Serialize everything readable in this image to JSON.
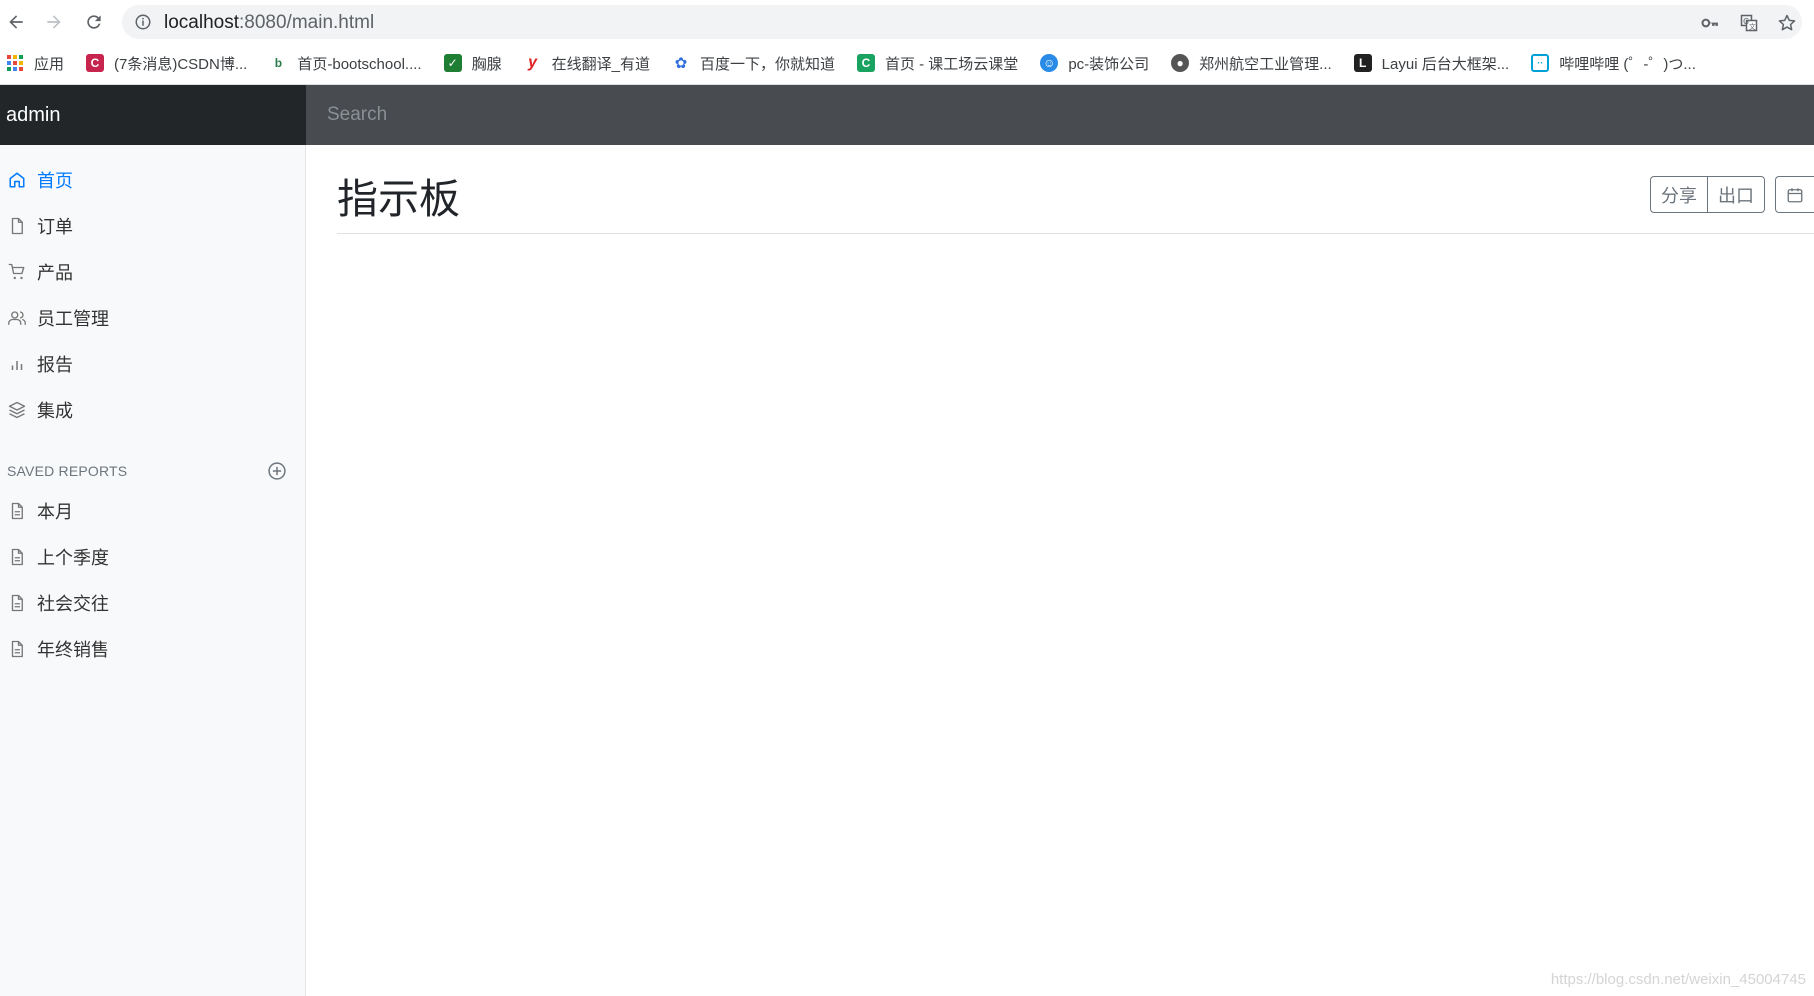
{
  "browser": {
    "url_host": "localhost",
    "url_rest": ":8080/main.html",
    "bookmarks": [
      {
        "label": "应用",
        "icon": "apps-grid-icon",
        "color": "#e8453c"
      },
      {
        "label": "(7条消息)CSDN博...",
        "icon": "csdn-icon",
        "color": "#c7254e"
      },
      {
        "label": "首页-bootschool....",
        "icon": "bootschool-icon",
        "color": "#2b7a4b"
      },
      {
        "label": "胸腺",
        "icon": "leaf-icon",
        "color": "#1e7e34"
      },
      {
        "label": "在线翻译_有道",
        "icon": "youdao-icon",
        "color": "#e02020"
      },
      {
        "label": "百度一下，你就知道",
        "icon": "baidu-paw-icon",
        "color": "#2f6fe0"
      },
      {
        "label": "首页 - 课工场云课堂",
        "icon": "kgc-icon",
        "color": "#1aa260"
      },
      {
        "label": "pc-装饰公司",
        "icon": "mascot-icon",
        "color": "#2a8be6"
      },
      {
        "label": "郑州航空工业管理...",
        "icon": "globe-icon",
        "color": "#555555"
      },
      {
        "label": "Layui 后台大框架...",
        "icon": "layui-icon",
        "color": "#222222"
      },
      {
        "label": "哔哩哔哩 (゜-゜)つ...",
        "icon": "bilibili-icon",
        "color": "#00a1d6"
      }
    ]
  },
  "header": {
    "brand": "admin",
    "search_placeholder": "Search"
  },
  "sidebar": {
    "items": [
      {
        "label": "首页",
        "icon": "home-icon",
        "active": true
      },
      {
        "label": "订单",
        "icon": "file-icon",
        "active": false
      },
      {
        "label": "产品",
        "icon": "shopping-cart-icon",
        "active": false
      },
      {
        "label": "员工管理",
        "icon": "users-icon",
        "active": false
      },
      {
        "label": "报告",
        "icon": "bar-chart-icon",
        "active": false
      },
      {
        "label": "集成",
        "icon": "layers-icon",
        "active": false
      }
    ],
    "saved_reports_heading": "SAVED REPORTS",
    "reports": [
      {
        "label": "本月",
        "icon": "file-text-icon"
      },
      {
        "label": "上个季度",
        "icon": "file-text-icon"
      },
      {
        "label": "社会交往",
        "icon": "file-text-icon"
      },
      {
        "label": "年终销售",
        "icon": "file-text-icon"
      }
    ]
  },
  "main": {
    "title": "指示板",
    "share_label": "分享",
    "export_label": "出口"
  },
  "watermark": "https://blog.csdn.net/weixin_45004745",
  "colors": {
    "accent": "#007bff",
    "brand_bg": "#232629",
    "topbar_bg": "#484c51",
    "sidebar_bg": "#f8f9fa"
  }
}
